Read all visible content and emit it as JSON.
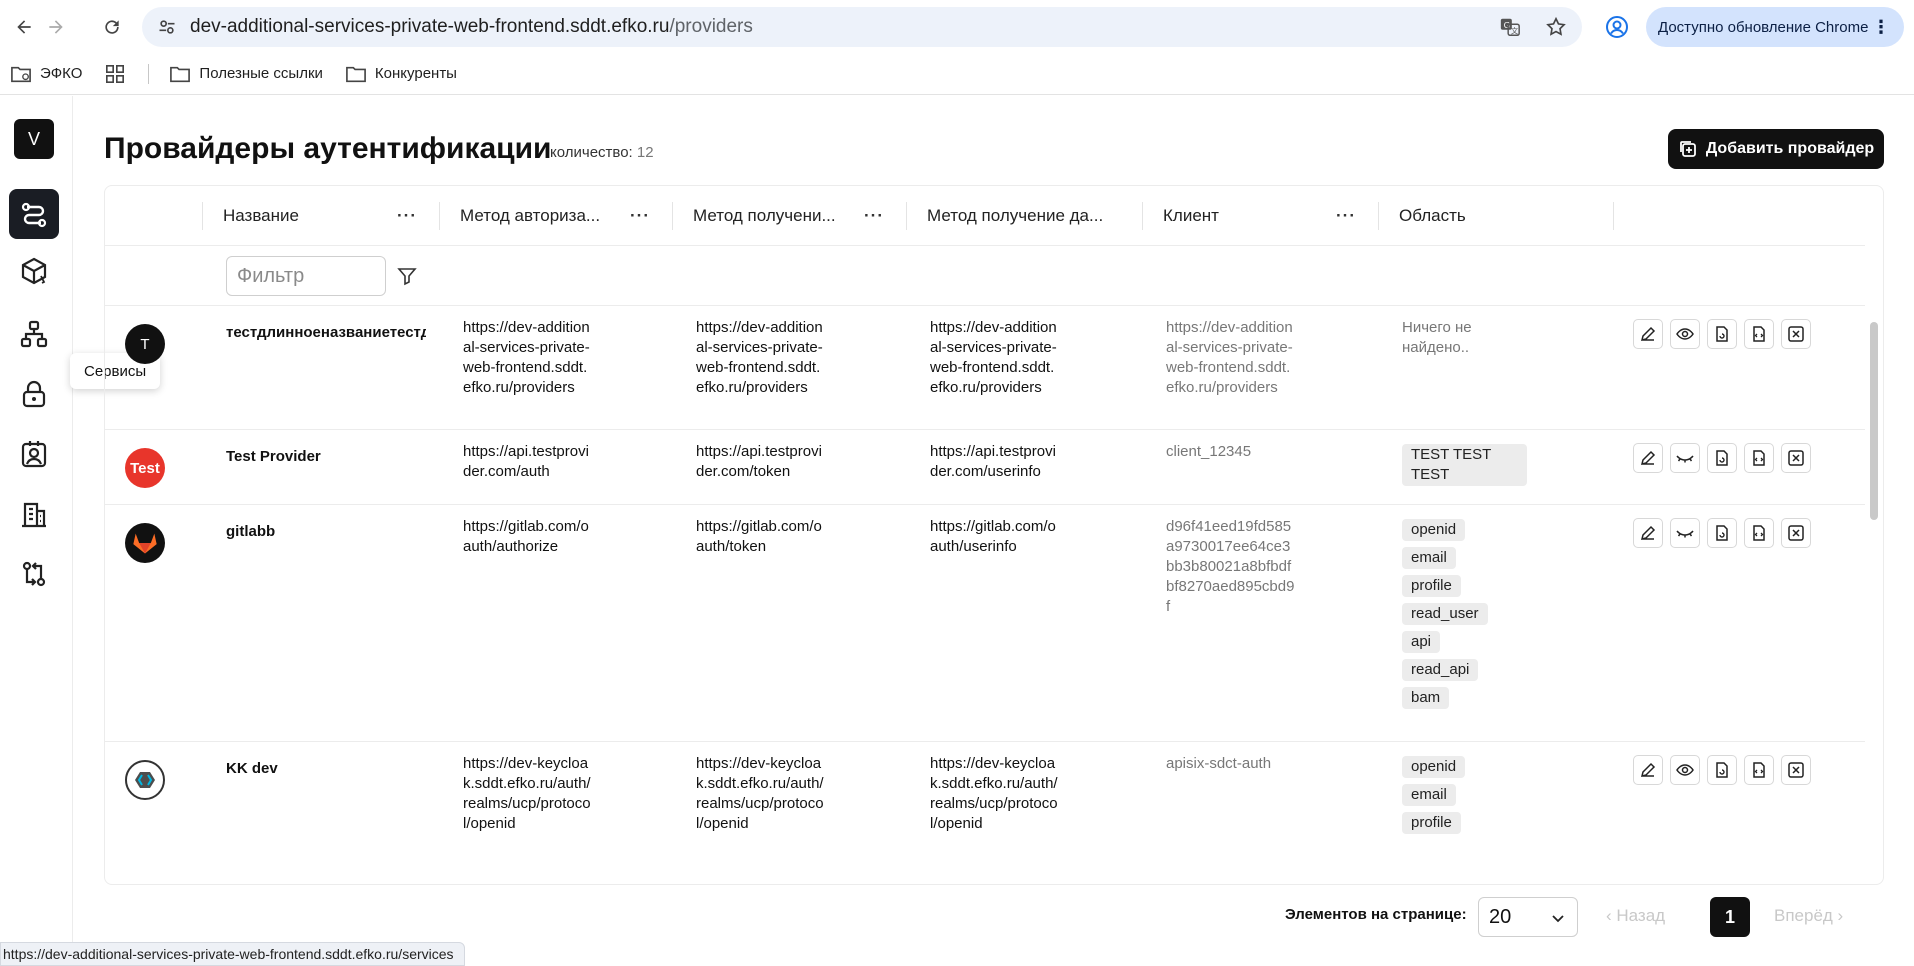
{
  "browser": {
    "url_host": "dev-additional-services-private-web-frontend.sddt.efko.ru",
    "url_path": "/providers",
    "update_label": "Доступно обновление Chrome"
  },
  "bookmarks": [
    {
      "label": "ЭФКО"
    },
    {
      "label": "Полезные ссылки"
    },
    {
      "label": "Конкуренты"
    }
  ],
  "sidebar": {
    "avatar_letter": "V",
    "tooltip": "Сервисы"
  },
  "page": {
    "title": "Провайдеры аутентификации",
    "count_label": "количество:",
    "count_value": "12",
    "add_button": "Добавить провайдер"
  },
  "table": {
    "columns": [
      {
        "label": "Название"
      },
      {
        "label": "Метод авториза..."
      },
      {
        "label": "Метод получени..."
      },
      {
        "label": "Метод получение да..."
      },
      {
        "label": "Клиент"
      },
      {
        "label": "Область"
      }
    ],
    "filter_placeholder": "Фильтр",
    "rows": [
      {
        "logo_text": "T",
        "logo_color": "#111111",
        "name": "тестдлинноеназваниетестдлинноеназвание",
        "auth": "https://dev-additional-services-private-web-frontend.sddt.efko.ru/providers",
        "token": "https://dev-additional-services-private-web-frontend.sddt.efko.ru/providers",
        "userinfo": "https://dev-additional-services-private-web-frontend.sddt.efko.ru/providers",
        "client": "https://dev-additional-services-private-web-frontend.sddt.efko.ru/providers",
        "scope_empty": "Ничего не найдено.."
      },
      {
        "logo_text": "Test",
        "logo_color": "#e8352b",
        "name": "Test Provider",
        "auth": "https://api.testprovider.com/auth",
        "token": "https://api.testprovider.com/token",
        "userinfo": "https://api.testprovider.com/userinfo",
        "client": "client_12345",
        "scopes": [
          "TEST TEST TEST"
        ]
      },
      {
        "logo_text": "gitlab",
        "logo_color": "#111111",
        "name": "gitlabb",
        "auth": "https://gitlab.com/oauth/authorize",
        "token": "https://gitlab.com/oauth/token",
        "userinfo": "https://gitlab.com/oauth/userinfo",
        "client": "d96f41eed19fd585a9730017ee64ce3bb3b80021a8bfbdfbf8270aed895cbd9f",
        "scopes": [
          "openid",
          "email",
          "profile",
          "read_user",
          "api",
          "read_api",
          "bam"
        ]
      },
      {
        "logo_text": "kk",
        "logo_color": "#ffffff",
        "name": "KK dev",
        "auth": "https://dev-keycloak.sddt.efko.ru/auth/realms/ucp/protocol/openid",
        "token": "https://dev-keycloak.sddt.efko.ru/auth/realms/ucp/protocol/openid",
        "userinfo": "https://dev-keycloak.sddt.efko.ru/auth/realms/ucp/protocol/openid",
        "client": "apisix-sdct-auth",
        "scopes": [
          "openid",
          "email",
          "profile"
        ]
      }
    ]
  },
  "pagination": {
    "per_page_label": "Элементов на странице:",
    "per_page_value": "20",
    "prev_label": "Назад",
    "current_page": "1",
    "next_label": "Вперёд"
  },
  "status_url": "https://dev-additional-services-private-web-frontend.sddt.efko.ru/services"
}
